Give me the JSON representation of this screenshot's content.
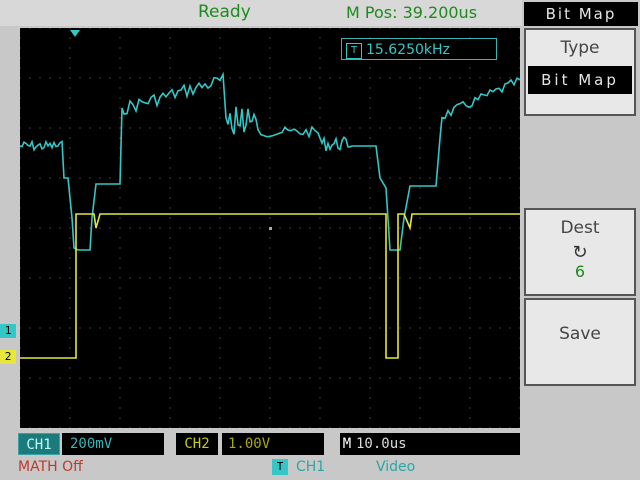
{
  "status": {
    "state": "Ready",
    "mpos": "M Pos: 39.200us"
  },
  "trigger_readout": {
    "icon": "T",
    "frequency": "15.6250kHz"
  },
  "menu": {
    "header": "Bit Map",
    "type_label": "Type",
    "type_value": "Bit Map",
    "dest_label": "Dest",
    "dest_icon": "rotate-knob-icon",
    "dest_value": "6",
    "save_label": "Save"
  },
  "channels": {
    "ch1_label": "CH1",
    "ch1_scale": "200mV",
    "ch2_label": "CH2",
    "ch2_scale": "1.00V",
    "time_label": "M",
    "time_scale": "10.0us",
    "ch1_marker": "1",
    "ch2_marker": "2"
  },
  "bottom": {
    "math": "MATH Off",
    "trig_icon": "T",
    "trig_source": "CH1",
    "trig_mode": "Video"
  },
  "colors": {
    "ch1": "#35c6c6",
    "ch2": "#e6e63c",
    "status_green": "#1e8a1e",
    "screen": "#000000",
    "math": "#c0392b"
  }
}
